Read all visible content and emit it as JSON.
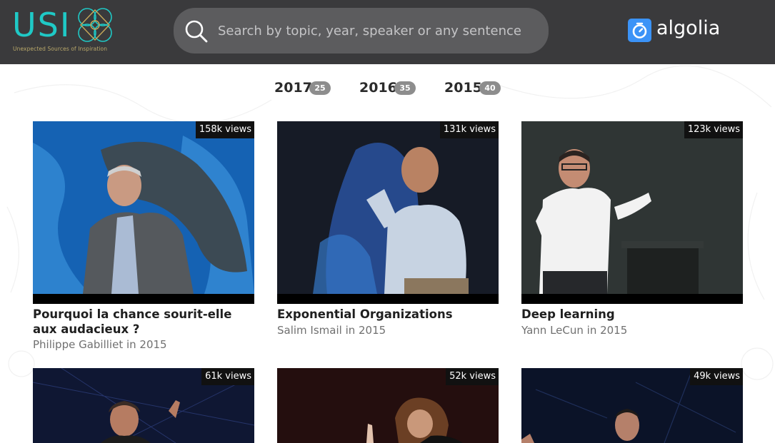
{
  "header": {
    "logo_text": "USI",
    "logo_tagline": "Unexpected Sources of Inspiration",
    "search_placeholder": "Search by topic, year, speaker or any sentence",
    "search_value": "",
    "partner_label": "algolia",
    "colors": {
      "header_bg": "#3a3a3c",
      "logo_accent": "#1fc9c6",
      "algolia_blue": "#3b93f7"
    }
  },
  "filters": {
    "years": [
      {
        "label": "2017",
        "count": "25"
      },
      {
        "label": "2016",
        "count": "35"
      },
      {
        "label": "2015",
        "count": "40"
      }
    ]
  },
  "talks": [
    {
      "title": "Pourquoi la chance sourit-elle aux audacieux ?",
      "meta": "Philippe Gabilliet in 2015",
      "views": "158k views"
    },
    {
      "title": "Exponential Organizations",
      "meta": "Salim Ismail in 2015",
      "views": "131k views"
    },
    {
      "title": "Deep learning",
      "meta": "Yann LeCun in 2015",
      "views": "123k views"
    },
    {
      "title": "",
      "meta": "",
      "views": "61k views"
    },
    {
      "title": "",
      "meta": "",
      "views": "52k views"
    },
    {
      "title": "",
      "meta": "",
      "views": "49k views"
    }
  ]
}
